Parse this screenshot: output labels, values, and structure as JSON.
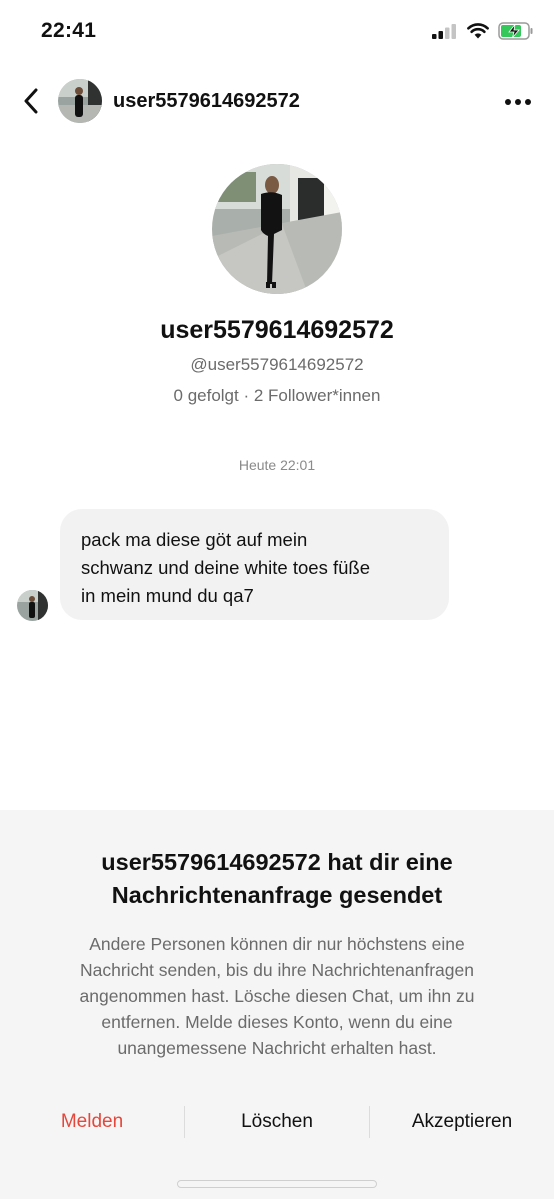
{
  "status_bar": {
    "time": "22:41"
  },
  "header": {
    "username": "user5579614692572",
    "back_icon": "chevron-left-icon",
    "more_icon": "more-horizontal-icon"
  },
  "profile": {
    "display_name": "user5579614692572",
    "handle": "@user5579614692572",
    "stats": "0 gefolgt · 2 Follower*innen"
  },
  "conversation": {
    "timestamp": "Heute 22:01",
    "messages": [
      {
        "line1": "pack ma diese göt auf mein",
        "line2": "schwanz und deine white toes füße",
        "line3": "in mein mund du qa7"
      }
    ]
  },
  "request_panel": {
    "title_line1": "user5579614692572 hat dir eine",
    "title_line2": "Nachrichtenanfrage gesendet",
    "desc_line1": "Andere Personen können dir nur höchstens eine",
    "desc_line2": "Nachricht senden, bis du ihre Nachrichtenanfragen",
    "desc_line3": "angenommen hast. Lösche diesen Chat, um ihn zu",
    "desc_line4": "entfernen. Melde dieses Konto, wenn du eine",
    "desc_line5": "unangemessene Nachricht erhalten hast.",
    "actions": {
      "report": "Melden",
      "delete": "Löschen",
      "accept": "Akzeptieren"
    }
  },
  "colors": {
    "report": "#e5473c",
    "bubble": "#f2f2f2",
    "panel": "#f5f5f5",
    "battery_fill": "#34c759"
  }
}
